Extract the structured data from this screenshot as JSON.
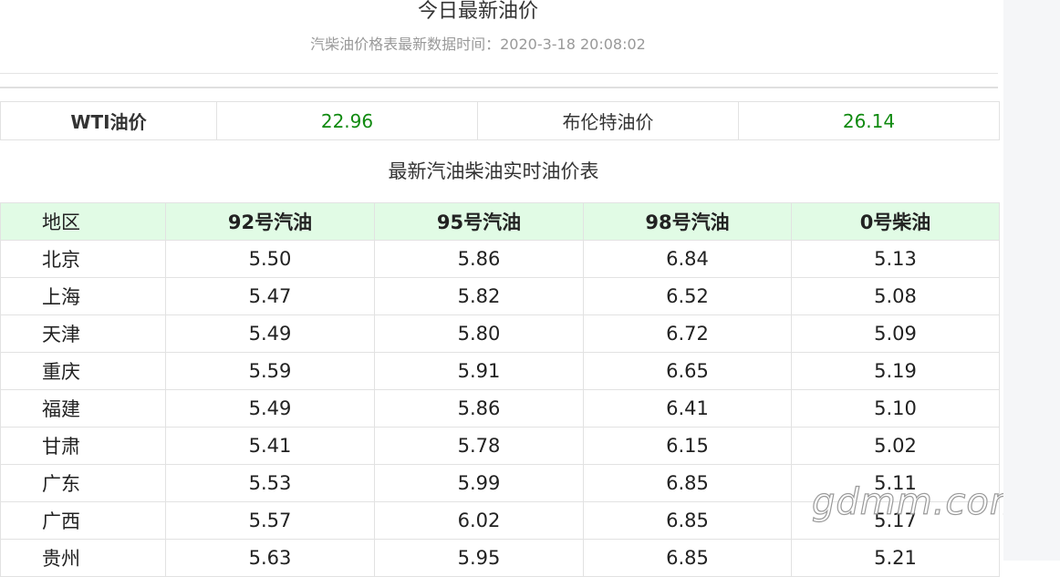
{
  "header": {
    "title": "今日最新油价",
    "subtitle": "汽柴油价格表最新数据时间：2020-3-18 20:08:02"
  },
  "crude": {
    "wti_label": "WTI油价",
    "wti_value": "22.96",
    "brent_label": "布伦特油价",
    "brent_value": "26.14"
  },
  "table": {
    "heading": "最新汽油柴油实时油价表",
    "columns": [
      "地区",
      "92号汽油",
      "95号汽油",
      "98号汽油",
      "0号柴油"
    ],
    "rows": [
      [
        "北京",
        "5.50",
        "5.86",
        "6.84",
        "5.13"
      ],
      [
        "上海",
        "5.47",
        "5.82",
        "6.52",
        "5.08"
      ],
      [
        "天津",
        "5.49",
        "5.80",
        "6.72",
        "5.09"
      ],
      [
        "重庆",
        "5.59",
        "5.91",
        "6.65",
        "5.19"
      ],
      [
        "福建",
        "5.49",
        "5.86",
        "6.41",
        "5.10"
      ],
      [
        "甘肃",
        "5.41",
        "5.78",
        "6.15",
        "5.02"
      ],
      [
        "广东",
        "5.53",
        "5.99",
        "6.85",
        "5.11"
      ],
      [
        "广西",
        "5.57",
        "6.02",
        "6.85",
        "5.17"
      ],
      [
        "贵州",
        "5.63",
        "5.95",
        "6.85",
        "5.21"
      ]
    ]
  },
  "watermark": "gdmm.com",
  "colors": {
    "value_green": "#108a10",
    "header_bg": "#e1fbe5",
    "border": "#e2e2e2",
    "sidebar_bg": "#f5f6f8"
  }
}
